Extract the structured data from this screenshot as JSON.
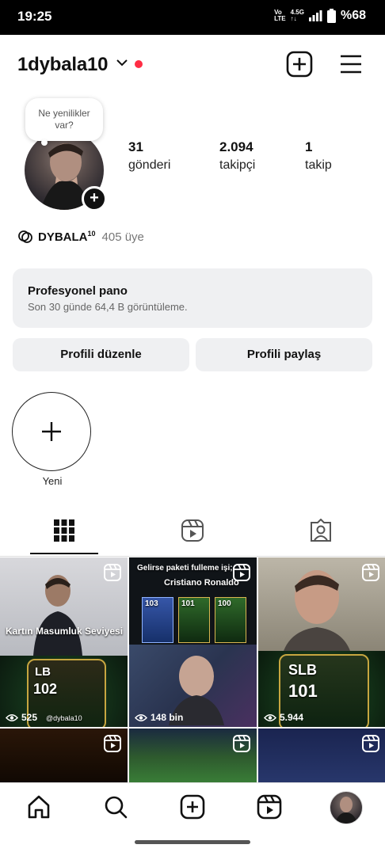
{
  "status_bar": {
    "time": "19:25",
    "network": "VoLTE 4.5G",
    "battery": "%68"
  },
  "profile": {
    "username": "1dybala10"
  },
  "note_bubble": {
    "line1": "Ne yenilikler",
    "line2": "var?"
  },
  "stats": [
    {
      "value": "31",
      "label": "gönderi"
    },
    {
      "value": "2.094",
      "label": "takipçi"
    },
    {
      "value": "1",
      "label": "takip"
    }
  ],
  "channel": {
    "name": "DYBALA",
    "sup": "10",
    "members": "405 üye"
  },
  "dashboard": {
    "title": "Profesyonel pano",
    "subtitle": "Son 30 günde 64,4 B görüntüleme."
  },
  "buttons": {
    "edit": "Profili düzenle",
    "share": "Profili paylaş"
  },
  "highlight": {
    "new_label": "Yeni"
  },
  "posts": [
    {
      "views": "525",
      "caption": "Kartın Masumluk Seviyesi",
      "card_pos": "LB",
      "card_rating": "102",
      "watermark": "@dybala10"
    },
    {
      "views": "148 bin",
      "caption": "Gelirse paketi fulleme işi;",
      "title": "Cristiano Ronaldo",
      "ratings": [
        "103",
        "101",
        "100"
      ]
    },
    {
      "views": "5.944",
      "card_pos": "SLB",
      "card_rating": "101"
    },
    {
      "views": ""
    },
    {
      "views": ""
    },
    {
      "views": ""
    }
  ],
  "colors": {
    "accent_red": "#ff2d44",
    "surface_gray": "#eff0f2"
  }
}
